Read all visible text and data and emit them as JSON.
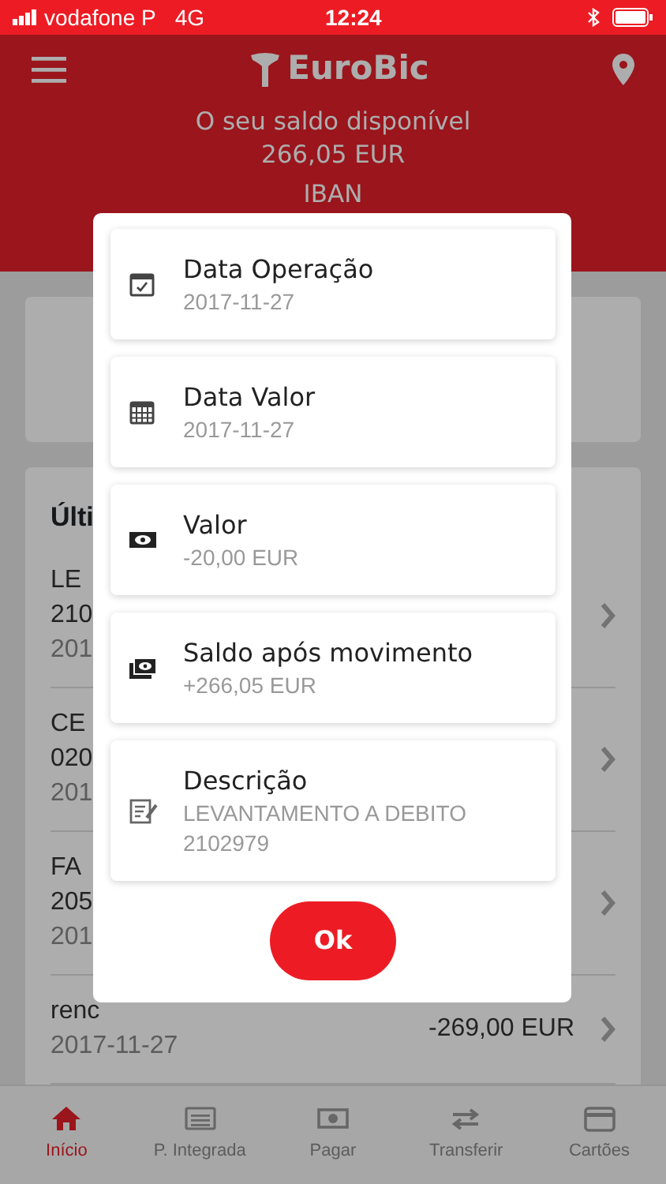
{
  "status_bar": {
    "carrier": "vodafone P",
    "network": "4G",
    "time": "12:24"
  },
  "header": {
    "logo": "EuroBic",
    "balance_label": "O seu saldo disponível",
    "balance": "266,05 EUR",
    "iban_label": "IBAN"
  },
  "movements": {
    "title": "Últi",
    "rows": [
      {
        "lines": [
          "LE",
          "210"
        ],
        "date": "201"
      },
      {
        "lines": [
          "CE",
          "020"
        ],
        "date": "201"
      },
      {
        "lines": [
          "FA",
          "205"
        ],
        "date": "201"
      },
      {
        "lines": [
          "renc"
        ],
        "date": "2017-11-27",
        "amount": "-269,00 EUR"
      }
    ]
  },
  "dialog": {
    "fields": [
      {
        "kind": "operation-date",
        "label": "Data Operação",
        "value": [
          "2017-11-27"
        ]
      },
      {
        "kind": "value-date",
        "label": "Data Valor",
        "value": [
          "2017-11-27"
        ]
      },
      {
        "kind": "amount",
        "label": "Valor",
        "value": [
          "-20,00 EUR"
        ]
      },
      {
        "kind": "balance",
        "label": "Saldo após movimento",
        "value": [
          "+266,05 EUR"
        ]
      },
      {
        "kind": "description",
        "label": "Descrição",
        "value": [
          "LEVANTAMENTO A DEBITO",
          "2102979"
        ]
      }
    ],
    "ok_button": "Ok"
  },
  "tab_bar": [
    {
      "kind": "home",
      "label": "Início",
      "selected": true
    },
    {
      "kind": "statement",
      "label": "P. Integrada",
      "selected": false
    },
    {
      "kind": "pay",
      "label": "Pagar",
      "selected": false
    },
    {
      "kind": "transfer",
      "label": "Transferir",
      "selected": false
    },
    {
      "kind": "cards",
      "label": "Cartões",
      "selected": false
    }
  ]
}
